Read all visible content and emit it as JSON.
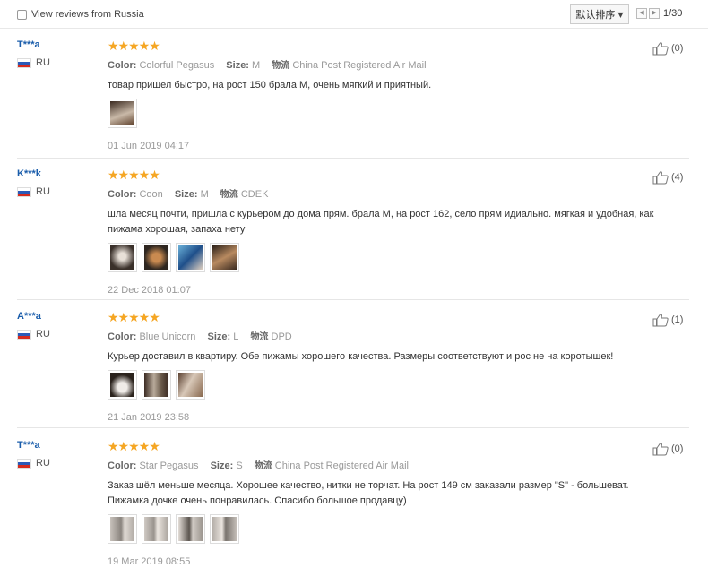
{
  "filter": {
    "label": "View reviews from Russia",
    "checked": false
  },
  "sort": {
    "label": "默认排序"
  },
  "pager": {
    "text": "1/30"
  },
  "reviews": [
    {
      "user": "T***a",
      "country": "RU",
      "attrs": [
        {
          "key": "Color:",
          "value": "Colorful Pegasus"
        },
        {
          "key": "Size:",
          "value": "M"
        },
        {
          "key": "物流",
          "value": "China Post Registered Air Mail"
        }
      ],
      "text": "товар пришел быстро, на рост 150 брала М, очень мягкий и приятный.",
      "date": "01 Jun 2019 04:17",
      "helpful": "(0)",
      "photos": [
        "#8a6a4a"
      ]
    },
    {
      "user": "K***k",
      "country": "RU",
      "attrs": [
        {
          "key": "Color:",
          "value": "Coon"
        },
        {
          "key": "Size:",
          "value": "M"
        },
        {
          "key": "物流",
          "value": "CDEK"
        }
      ],
      "text": "шла месяц почти, пришла с курьером до дома прям. брала М, на рост 162, село прям идиально. мягкая и удобная, как пижама хорошая, запаха нету",
      "date": "22 Dec 2018 01:07",
      "helpful": "(4)",
      "photos": [
        "#5a4e44",
        "#7a4a30",
        "#3a6a9a",
        "#6a5040"
      ]
    },
    {
      "user": "A***a",
      "country": "RU",
      "attrs": [
        {
          "key": "Color:",
          "value": "Blue Unicorn"
        },
        {
          "key": "Size:",
          "value": "L"
        },
        {
          "key": "物流",
          "value": "DPD"
        }
      ],
      "text": "Курьер доставил в квартиру. Обе пижамы хорошего качества. Размеры соответствуют и рос не на коротышек!",
      "date": "21 Jan 2019 23:58",
      "helpful": "(1)",
      "photos": [
        "#4a3a30",
        "#8a7a6a",
        "#9a8470"
      ]
    },
    {
      "user": "T***a",
      "country": "RU",
      "attrs": [
        {
          "key": "Color:",
          "value": "Star Pegasus"
        },
        {
          "key": "Size:",
          "value": "S"
        },
        {
          "key": "物流",
          "value": "China Post Registered Air Mail"
        }
      ],
      "text": "Заказ шёл меньше месяца. Хорошее качество, нитки не торчат. На рост 149 см заказали размер \"S\" - большеват. Пижамка дочке очень понравилась. Спасибо большое продавцу)",
      "date": "19 Mar 2019 08:55",
      "helpful": "(0)",
      "photos": [
        "#b0aaa4",
        "#a8a29c",
        "#9c968f",
        "#b4aea8"
      ]
    }
  ]
}
